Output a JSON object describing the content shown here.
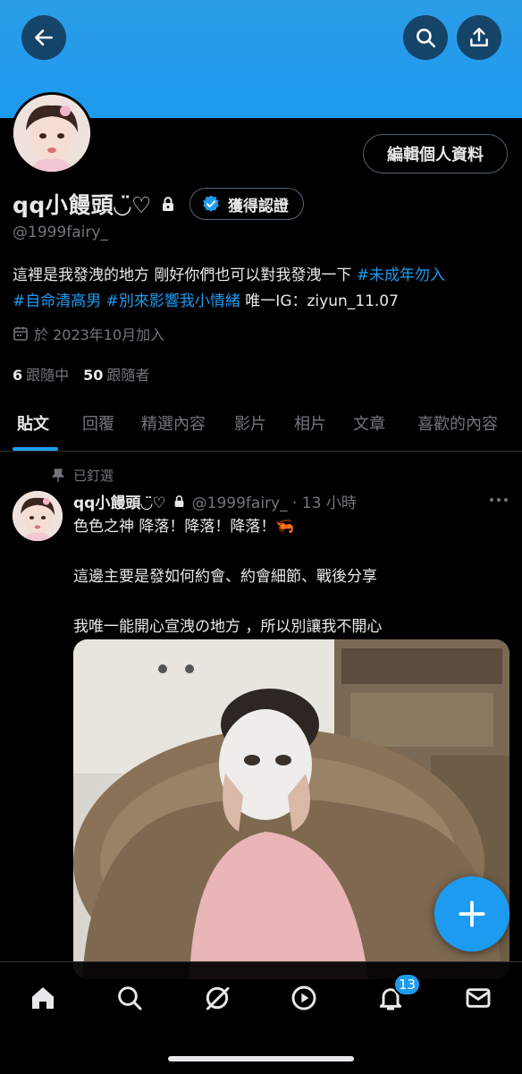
{
  "profile": {
    "display_name": "qq小饅頭◡̈♡",
    "handle": "@1999fairy_",
    "edit_button": "編輯個人資料",
    "verify_button": "獲得認證",
    "bio_text": "這裡是我發洩的地方 剛好你們也可以對我發洩一下 ",
    "bio_tags": [
      "#未成年勿入",
      "#自命清高男",
      "#別來影響我小情緒"
    ],
    "bio_suffix": " 唯一IG：ziyun_11.07",
    "joined": "於 2023年10月加入",
    "following_count": "6",
    "following_label": "跟隨中",
    "followers_count": "50",
    "followers_label": "跟隨者"
  },
  "tabs": [
    "貼文",
    "回覆",
    "精選內容",
    "影片",
    "相片",
    "文章",
    "喜歡的內容"
  ],
  "pinned_label": "已釘選",
  "post": {
    "author": "qq小饅頭◡̈♡",
    "handle_time": "@1999fairy_ · 13 小時",
    "lines": [
      "色色之神 降落！降落！降落！🦐",
      "這邊主要是發如何約會、約會細節、戰後分享",
      "我唯一能開心宣洩の地方 ，所以別讓我不開心"
    ]
  },
  "notifications_badge": "13",
  "colors": {
    "accent": "#1d9bf0",
    "banner": "#1d9bf0",
    "muted": "#71767b",
    "background": "#000000"
  },
  "icons": [
    "back-arrow-icon",
    "search-icon",
    "share-icon",
    "lock-icon",
    "verified-badge-icon",
    "calendar-icon",
    "pin-icon",
    "more-icon",
    "plus-icon",
    "home-icon",
    "explore-icon",
    "grok-icon",
    "video-icon",
    "bell-icon",
    "mail-icon"
  ]
}
